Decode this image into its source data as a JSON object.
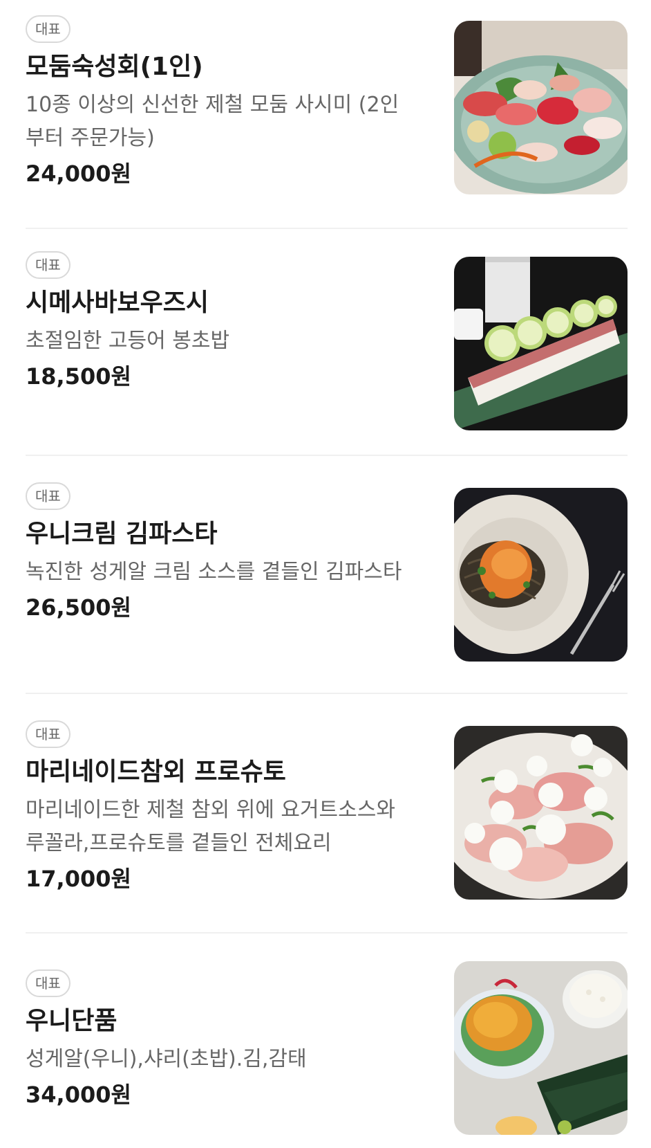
{
  "menu": {
    "items": [
      {
        "badge": "대표",
        "name": "모둠숙성회(1인)",
        "description": "10종 이상의 신선한 제철 모둠 사시미 (2인부터 주문가능)",
        "price": "24,000원",
        "image": "sashimi-platter"
      },
      {
        "badge": "대표",
        "name": "시메사바보우즈시",
        "description": "초절임한 고등어 봉초밥",
        "price": "18,500원",
        "image": "mackerel-bouzushi"
      },
      {
        "badge": "대표",
        "name": "우니크림 김파스타",
        "description": "녹진한 성게알 크림 소스를 곁들인 김파스타",
        "price": "26,500원",
        "image": "uni-cream-pasta"
      },
      {
        "badge": "대표",
        "name": "마리네이드참외 프로슈토",
        "description": "마리네이드한 제철 참외 위에 요거트소스와 루꼴라,프로슈토를 곁들인 전체요리",
        "price": "17,000원",
        "image": "melon-prosciutto"
      },
      {
        "badge": "대표",
        "name": "우니단품",
        "description": "성게알(우니),샤리(초밥).김,감태",
        "price": "34,000원",
        "image": "uni-rice-set"
      }
    ]
  },
  "colors": {
    "text_primary": "#1b1b1b",
    "text_secondary": "#666666",
    "badge_border": "#d9d9d9",
    "divider": "#f0f0f0"
  }
}
